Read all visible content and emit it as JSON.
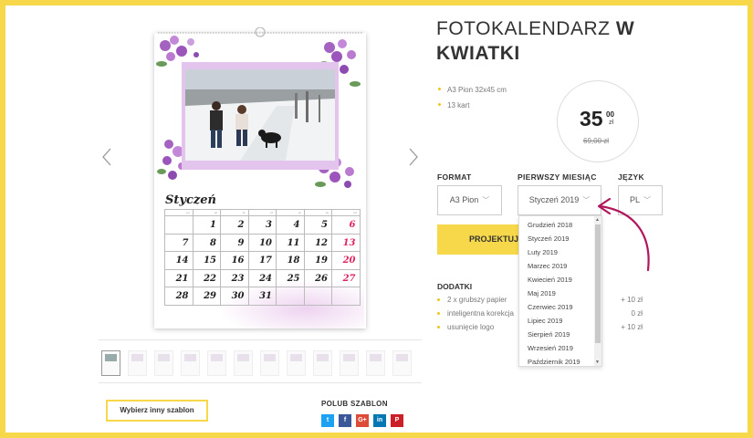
{
  "gallery": {
    "prev_icon": "chevron-left-icon",
    "next_icon": "chevron-right-icon",
    "month_title": "Styczeń",
    "weekday_headers": [
      "pn",
      "wt",
      "śr",
      "cz",
      "pt",
      "so",
      "nd"
    ],
    "weeks": [
      [
        "",
        "",
        "",
        "",
        "",
        "",
        "1"
      ],
      [
        "",
        "",
        "",
        "",
        "",
        "",
        ""
      ],
      [
        "",
        "",
        "",
        "",
        "",
        "",
        ""
      ],
      [
        "",
        "",
        "",
        "",
        "",
        "",
        ""
      ],
      [
        "",
        "",
        "",
        "",
        "",
        "",
        ""
      ]
    ],
    "days": [
      [
        "",
        "1",
        "2",
        "3",
        "4",
        "5",
        "6"
      ],
      [
        "7",
        "8",
        "9",
        "10",
        "11",
        "12",
        "13"
      ],
      [
        "14",
        "15",
        "16",
        "17",
        "18",
        "19",
        "20"
      ],
      [
        "21",
        "22",
        "23",
        "24",
        "25",
        "26",
        "27"
      ],
      [
        "28",
        "29",
        "30",
        "31",
        "",
        "",
        ""
      ]
    ],
    "thumbnail_count": 12,
    "choose_template_button": "Wybierz inny szablon",
    "like_label": "POLUB SZABLON",
    "social": [
      {
        "name": "twitter",
        "glyph": "t",
        "color": "#1da1f2"
      },
      {
        "name": "facebook",
        "glyph": "f",
        "color": "#3b5998"
      },
      {
        "name": "google-plus",
        "glyph": "G+",
        "color": "#dd4b39"
      },
      {
        "name": "linkedin",
        "glyph": "in",
        "color": "#0077b5"
      },
      {
        "name": "pinterest",
        "glyph": "P",
        "color": "#cb2027"
      }
    ]
  },
  "product": {
    "title_light": "FOTOKALENDARZ",
    "title_bold_1": "W",
    "title_bold_2": "KWIATKI",
    "specs": [
      "A3 Pion 32x45 cm",
      "13 kart"
    ],
    "price_main": "35",
    "price_cents": "00",
    "price_currency": "zł",
    "price_old": "69,00 zł",
    "format_label": "FORMAT",
    "format_value": "A3 Pion",
    "month_label": "PIERWSZY MIESIĄC",
    "month_value": "Styczeń 2019",
    "language_label": "JĘZYK",
    "language_value": "PL",
    "design_button": "PROJEKTUJ",
    "addons_label": "DODATKI",
    "addons": [
      {
        "label": "2 x grubszy papier",
        "price": "+ 10 zł"
      },
      {
        "label": "inteligentna korekcja",
        "price": "0 zł"
      },
      {
        "label": "usunięcie logo",
        "price": "+ 10 zł"
      }
    ],
    "month_options": [
      "Grudzień 2018",
      "Styczeń 2019",
      "Luty 2019",
      "Marzec 2019",
      "Kwiecień 2019",
      "Maj 2019",
      "Czerwiec 2019",
      "Lipiec 2019",
      "Sierpień 2019",
      "Wrzesień 2019",
      "Październik 2019"
    ]
  },
  "colors": {
    "accent": "#f7d84a",
    "sunday": "#e0245e",
    "annotation": "#b0175a"
  }
}
